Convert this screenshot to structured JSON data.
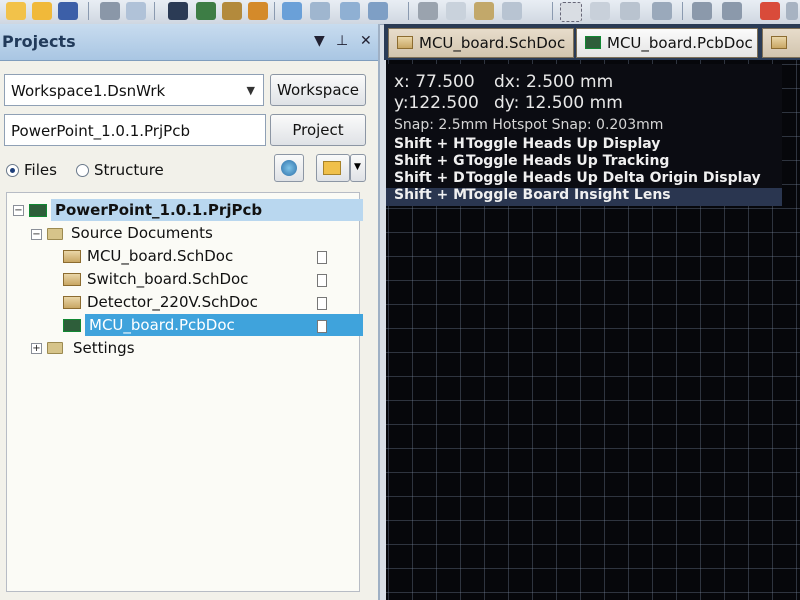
{
  "panel": {
    "title": "Projects",
    "workspace_combo": {
      "value": "Workspace1.DsnWrk"
    },
    "workspace_button": "Workspace",
    "project_field": {
      "value": "PowerPoint_1.0.1.PrjPcb"
    },
    "project_button": "Project",
    "view_options": {
      "files": "Files",
      "structure": "Structure",
      "selected": "Files"
    }
  },
  "tree": {
    "project": "PowerPoint_1.0.1.PrjPcb",
    "source_folder": "Source Documents",
    "documents": [
      "MCU_board.SchDoc",
      "Switch_board.SchDoc",
      "Detector_220V.SchDoc",
      "MCU_board.PcbDoc"
    ],
    "selected_document": "MCU_board.PcbDoc",
    "settings_folder": "Settings"
  },
  "tabs": [
    {
      "label": "MCU_board.SchDoc",
      "active": false
    },
    {
      "label": "MCU_board.PcbDoc",
      "active": true
    }
  ],
  "hud": {
    "x_label": "x: 77.500",
    "dx_label": "dx:  2.500  mm",
    "y_label": "y:122.500",
    "dy_label": "dy: 12.500  mm",
    "snap": "Snap: 2.5mm Hotspot Snap: 0.203mm",
    "shortcuts": [
      {
        "key": "Shift + H",
        "action": "Toggle Heads Up Display"
      },
      {
        "key": "Shift + G",
        "action": "Toggle Heads Up Tracking"
      },
      {
        "key": "Shift + D",
        "action": "Toggle Heads Up Delta Origin Display"
      },
      {
        "key": "Shift + M",
        "action": "Toggle Board Insight Lens"
      }
    ]
  },
  "colors": {
    "canvas_bg": "#06070b",
    "grid": "#78879f",
    "selection": "#3fa3dc",
    "panel_header": "#a9c6e3"
  }
}
